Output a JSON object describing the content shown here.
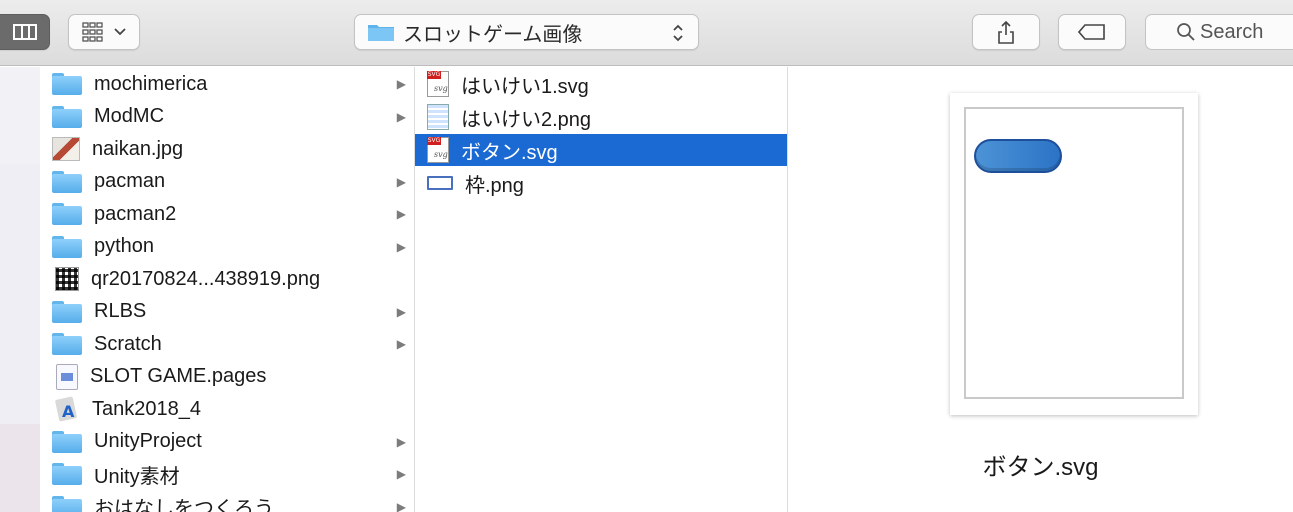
{
  "toolbar": {
    "view_icon": "columns-view-icon",
    "group_icon": "group-grid-icon",
    "path": {
      "title": "スロットゲーム画像",
      "icon": "folder-icon"
    },
    "share_icon": "share-icon",
    "tag_icon": "tag-icon",
    "search": {
      "placeholder": "Search",
      "icon": "search-icon"
    }
  },
  "column1": {
    "items": [
      {
        "label": "mochimerica",
        "type": "folder",
        "expandable": true
      },
      {
        "label": "ModMC",
        "type": "folder",
        "expandable": true
      },
      {
        "label": "naikan.jpg",
        "type": "image",
        "expandable": false
      },
      {
        "label": "pacman",
        "type": "folder",
        "expandable": true
      },
      {
        "label": "pacman2",
        "type": "folder",
        "expandable": true
      },
      {
        "label": "python",
        "type": "folder",
        "expandable": true
      },
      {
        "label": "qr20170824...438919.png",
        "type": "qr",
        "expandable": false
      },
      {
        "label": "RLBS",
        "type": "folder",
        "expandable": true
      },
      {
        "label": "Scratch",
        "type": "folder",
        "expandable": true
      },
      {
        "label": "SLOT GAME.pages",
        "type": "pages",
        "expandable": false
      },
      {
        "label": "Tank2018_4",
        "type": "app",
        "expandable": false
      },
      {
        "label": "UnityProject",
        "type": "folder",
        "expandable": true
      },
      {
        "label": "Unity素材",
        "type": "folder",
        "expandable": true
      },
      {
        "label": "おはなしをつくろう",
        "type": "folder",
        "expandable": true
      }
    ]
  },
  "column2": {
    "items": [
      {
        "label": "はいけい1.svg",
        "type": "svg",
        "selected": false
      },
      {
        "label": "はいけい2.png",
        "type": "png-wave",
        "selected": false
      },
      {
        "label": "ボタン.svg",
        "type": "svg",
        "selected": true
      },
      {
        "label": "枠.png",
        "type": "png-frame",
        "selected": false
      }
    ]
  },
  "preview": {
    "name": "ボタン.svg"
  },
  "colors": {
    "selection": "#1b6ad4",
    "folder": "#62b6ec",
    "pill": "#2c73c6"
  }
}
